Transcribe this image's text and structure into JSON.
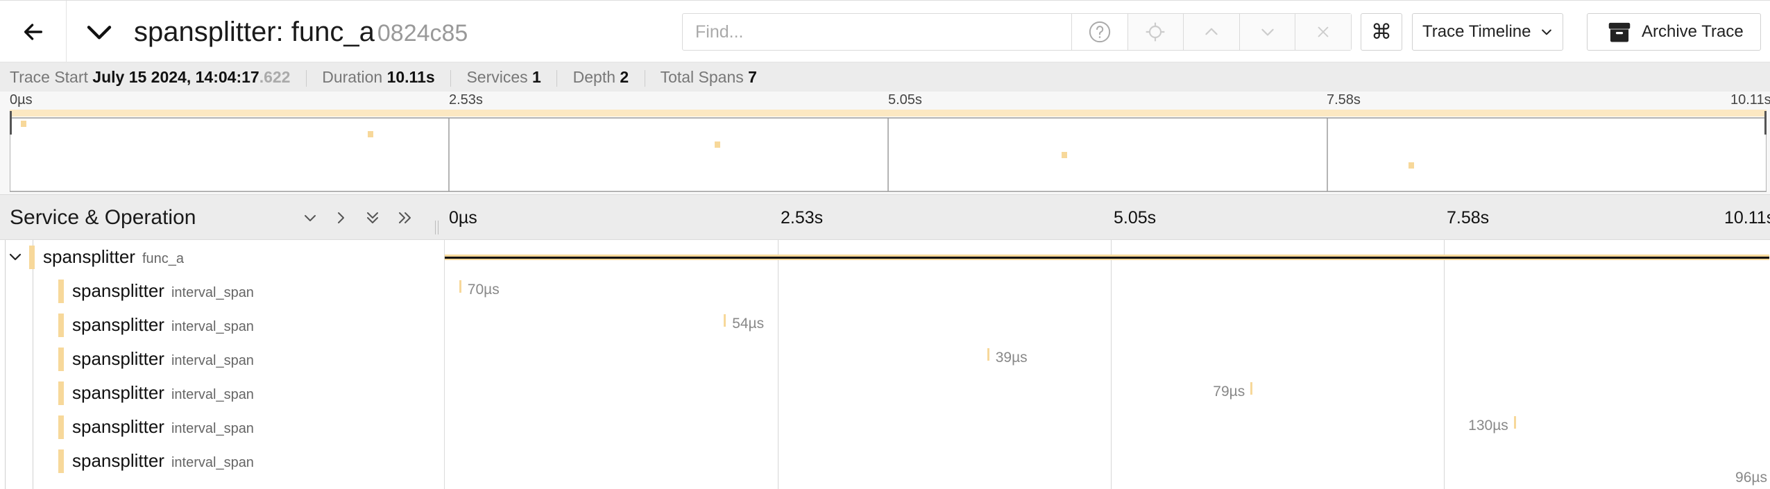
{
  "header": {
    "back_icon": "arrow-left-icon",
    "collapse_icon": "chevron-down-icon",
    "title": "spansplitter: func_a",
    "trace_id": "0824c85",
    "find_placeholder": "Find...",
    "shortcut_symbol": "⌘",
    "timeline_dropdown": "Trace Timeline",
    "archive_label": "Archive Trace"
  },
  "info": {
    "trace_start_label": "Trace Start",
    "trace_start_value": "July 15 2024, 14:04:17",
    "trace_start_ms": ".622",
    "duration_label": "Duration",
    "duration_value": "10.11s",
    "services_label": "Services",
    "services_value": "1",
    "depth_label": "Depth",
    "depth_value": "2",
    "total_spans_label": "Total Spans",
    "total_spans_value": "7"
  },
  "minimap": {
    "ticks": [
      "0µs",
      "2.53s",
      "5.05s",
      "7.58s",
      "10.11s"
    ]
  },
  "timeline": {
    "column_title": "Service & Operation",
    "ticks": [
      "0µs",
      "2.53s",
      "5.05s",
      "7.58s",
      "10.11s"
    ]
  },
  "colors": {
    "span": "#f7d89a",
    "root_line": "#111111"
  },
  "spans": [
    {
      "service": "spansplitter",
      "operation": "func_a",
      "start_s": 0.0,
      "duration_s": 10.11,
      "duration_label": "",
      "depth": 1
    },
    {
      "service": "spansplitter",
      "operation": "interval_span",
      "start_s": 0.11,
      "duration_s": 7e-05,
      "duration_label": "70µs",
      "depth": 2
    },
    {
      "service": "spansplitter",
      "operation": "interval_span",
      "start_s": 2.13,
      "duration_s": 5.4e-05,
      "duration_label": "54µs",
      "depth": 2
    },
    {
      "service": "spansplitter",
      "operation": "interval_span",
      "start_s": 4.14,
      "duration_s": 3.9e-05,
      "duration_label": "39µs",
      "depth": 2
    },
    {
      "service": "spansplitter",
      "operation": "interval_span",
      "start_s": 6.15,
      "duration_s": 7.9e-05,
      "duration_label": "79µs",
      "depth": 2
    },
    {
      "service": "spansplitter",
      "operation": "interval_span",
      "start_s": 8.16,
      "duration_s": 0.00013,
      "duration_label": "130µs",
      "depth": 2
    },
    {
      "service": "spansplitter",
      "operation": "interval_span",
      "start_s": 10.11,
      "duration_s": 9.6e-05,
      "duration_label": "96µs",
      "depth": 2
    }
  ]
}
